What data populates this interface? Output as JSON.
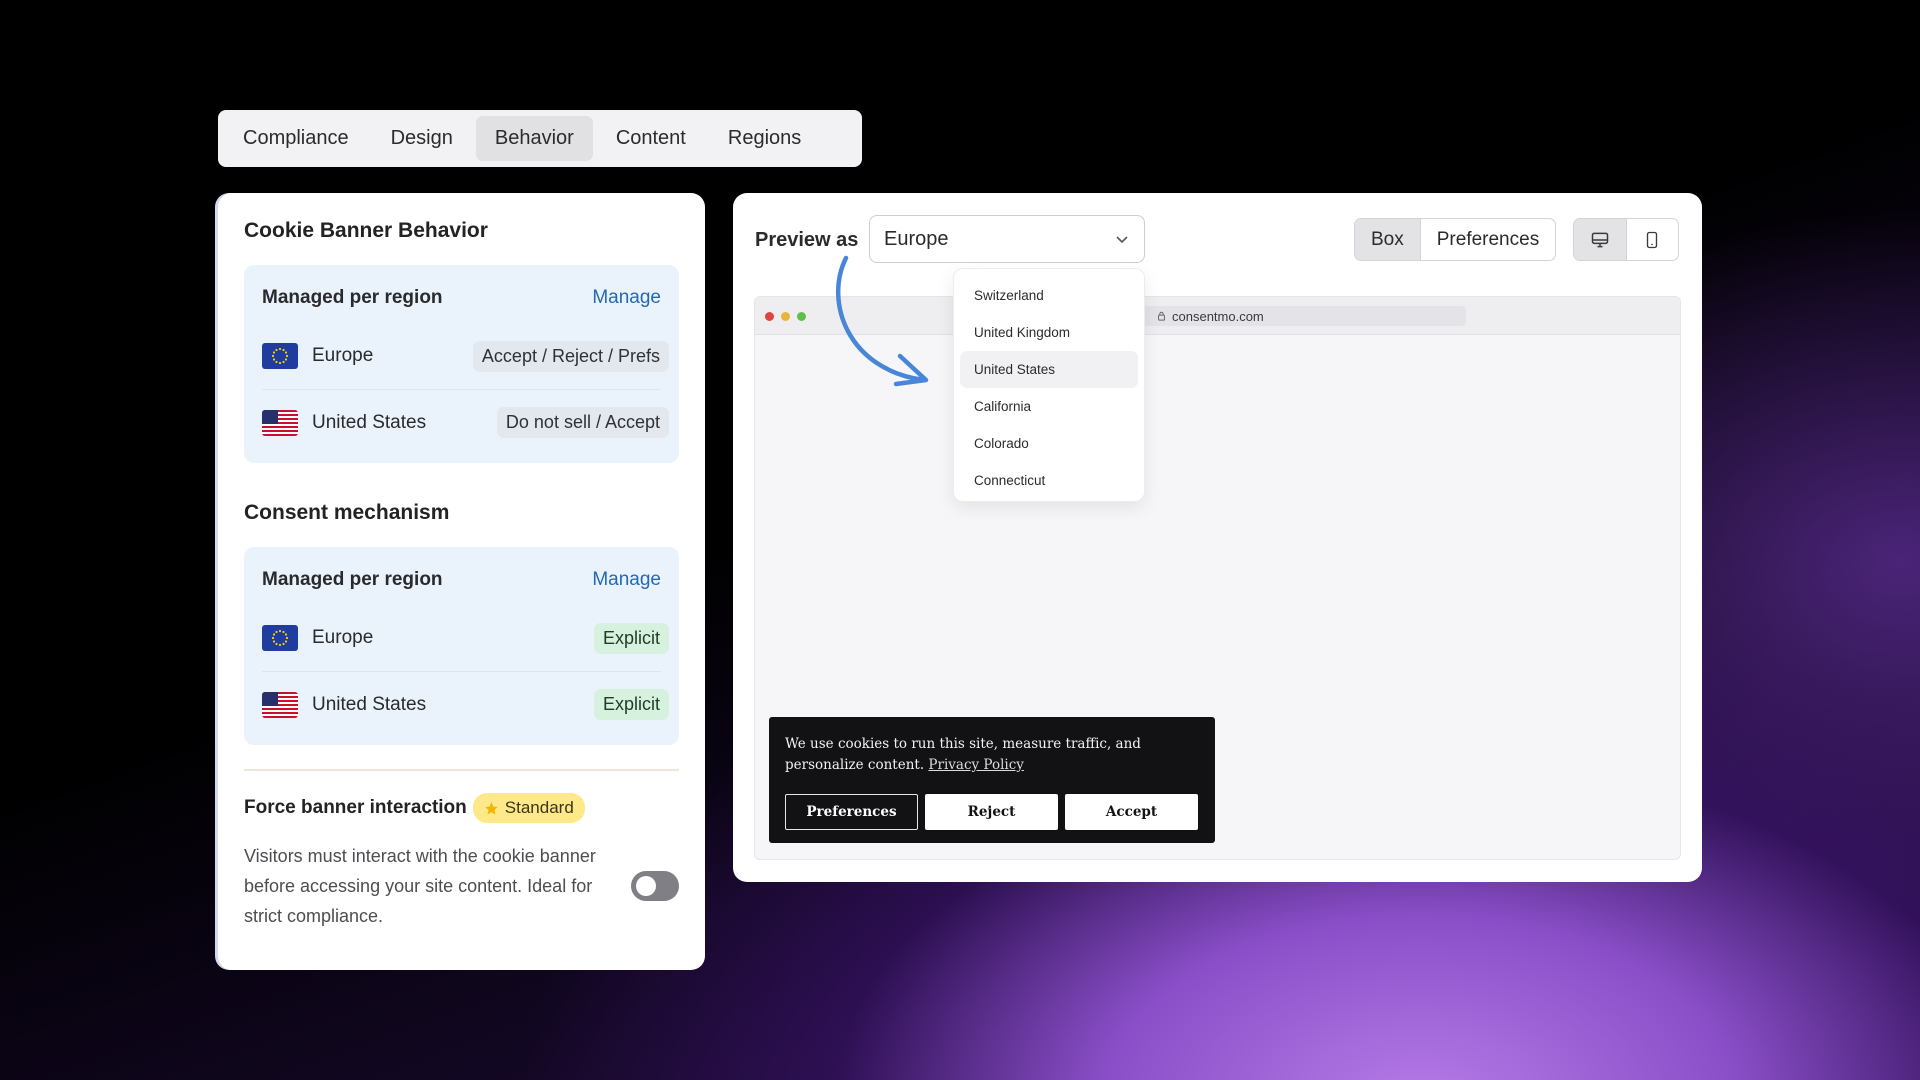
{
  "tabs": [
    {
      "label": "Compliance"
    },
    {
      "label": "Design"
    },
    {
      "label": "Behavior",
      "active": true
    },
    {
      "label": "Content"
    },
    {
      "label": "Regions"
    }
  ],
  "left": {
    "behavior": {
      "title": "Cookie Banner Behavior",
      "box_label": "Managed per region",
      "manage": "Manage",
      "rows": [
        {
          "region": "Europe",
          "value": "Accept / Reject / Prefs",
          "flag": "eu-flag-icon"
        },
        {
          "region": "United States",
          "value": "Do not sell / Accept",
          "flag": "us-flag-icon"
        }
      ]
    },
    "consent": {
      "title": "Consent mechanism",
      "box_label": "Managed per region",
      "manage": "Manage",
      "rows": [
        {
          "region": "Europe",
          "value": "Explicit",
          "flag": "eu-flag-icon"
        },
        {
          "region": "United States",
          "value": "Explicit",
          "flag": "us-flag-icon"
        }
      ]
    },
    "force": {
      "title": "Force banner interaction",
      "badge": "Standard",
      "badge_icon": "star-icon",
      "description": "Visitors must interact with the cookie banner before accessing your site content. Ideal for strict compliance.",
      "enabled": false
    }
  },
  "preview": {
    "label": "Preview as",
    "selected": "Europe",
    "modes": [
      {
        "label": "Box",
        "active": true
      },
      {
        "label": "Preferences"
      }
    ],
    "devices": [
      {
        "icon": "desktop-icon",
        "active": true
      },
      {
        "icon": "mobile-icon"
      }
    ],
    "url": "consentmo.com",
    "dropdown": [
      "Switzerland",
      "United Kingdom",
      "United States",
      "California",
      "Colorado",
      "Connecticut"
    ],
    "hovered": "United States"
  },
  "banner": {
    "text": "We use cookies to run this site, measure traffic, and personalize content.",
    "link": "Privacy Policy",
    "buttons": {
      "preferences": "Preferences",
      "reject": "Reject",
      "accept": "Accept"
    }
  },
  "colors": {
    "accent_link": "#2468b4",
    "region_box": "#eaf3fc",
    "badge": "#fde98a",
    "explicit_pill": "#d6f1dd",
    "arrow": "#4a86d8",
    "banner_bg": "#121214"
  }
}
